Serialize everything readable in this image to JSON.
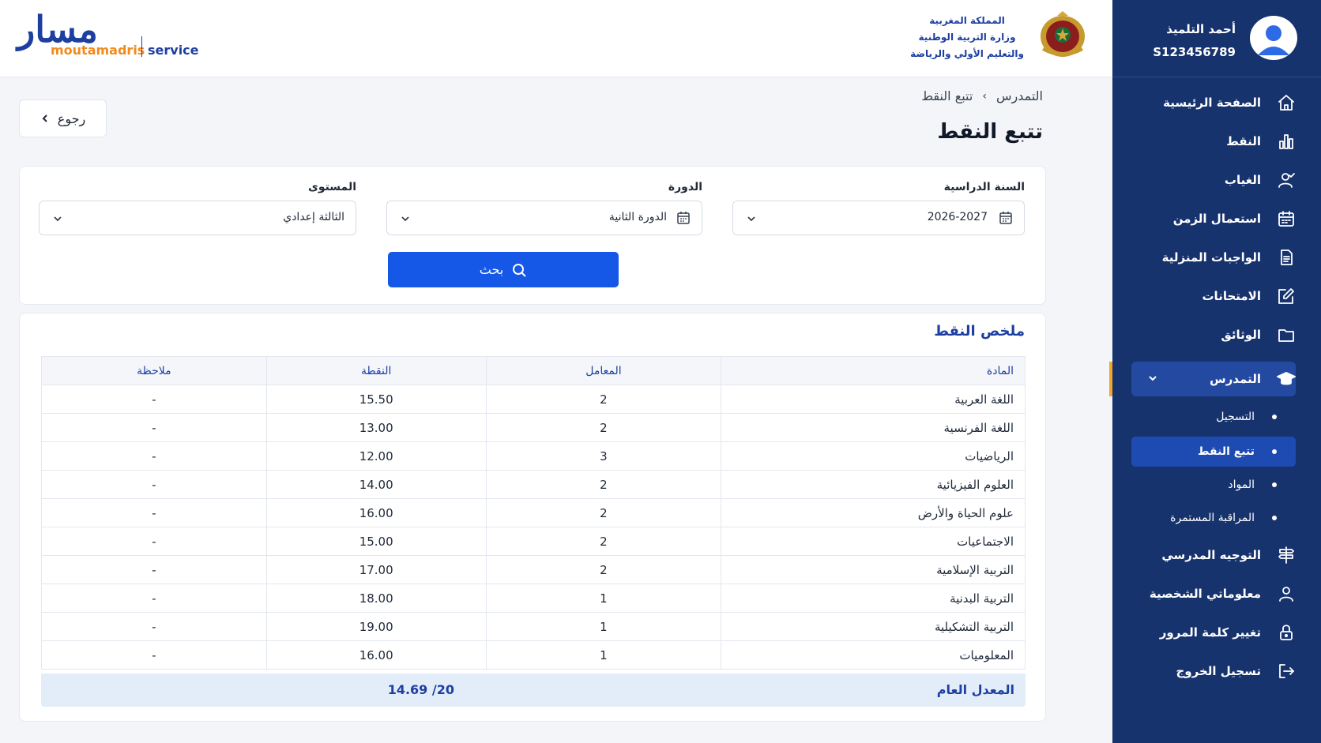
{
  "user": {
    "name": "أحمد التلميذ",
    "id": "S123456789"
  },
  "brand": {
    "logo_ar": "مسار",
    "logo_moutamadris": "moutamadris",
    "logo_service": "service"
  },
  "ministry": {
    "line1": "المملكة المغربية",
    "line2": "وزارة التربية الوطنية",
    "line3": "والتعليم الأولي والرياضة"
  },
  "sidebar": {
    "items": [
      {
        "label": "الصفحة الرئيسية",
        "icon": "home-icon"
      },
      {
        "label": "النقط",
        "icon": "bar-chart-icon"
      },
      {
        "label": "الغياب",
        "icon": "user-check-icon"
      },
      {
        "label": "استعمال الزمن",
        "icon": "calendar-icon"
      },
      {
        "label": "الواجبات المنزلية",
        "icon": "document-icon"
      },
      {
        "label": "الامتحانات",
        "icon": "edit-icon"
      },
      {
        "label": "الوثائق",
        "icon": "folder-icon"
      },
      {
        "label": "التمدرس",
        "icon": "graduation-cap-icon"
      },
      {
        "label": "التوجيه المدرسي",
        "icon": "signpost-icon"
      },
      {
        "label": "معلوماتي الشخصية",
        "icon": "user-icon"
      },
      {
        "label": "تغيير كلمة المرور",
        "icon": "lock-icon"
      },
      {
        "label": "تسجيل الخروج",
        "icon": "logout-icon"
      }
    ],
    "sub_items": [
      {
        "label": "التسجيل"
      },
      {
        "label": "تتبع النقط"
      },
      {
        "label": "المواد"
      },
      {
        "label": "المراقبة المستمرة"
      }
    ],
    "active_item": "التمدرس",
    "active_sub_item": "تتبع النقط"
  },
  "breadcrumb": {
    "parent": "التمدرس",
    "separator": "›",
    "current": "تتبع النقط"
  },
  "page_title": "تتبع النقط",
  "back_button": "رجوع",
  "filters": {
    "year_label": "السنة الدراسية",
    "year_value": "2026-2027",
    "session_label": "الدورة",
    "session_value": "الدورة الثانية",
    "level_label": "المستوى",
    "level_value": "الثالثة إعدادي",
    "search_button": "بحث"
  },
  "summary": {
    "title": "ملخص النقط",
    "columns": {
      "subject": "المادة",
      "coefficient": "المعامل",
      "grade": "النقطة",
      "note": "ملاحظة"
    },
    "rows": [
      {
        "subject": "اللغة العربية",
        "coefficient": "2",
        "grade": "15.50",
        "note": "-"
      },
      {
        "subject": "اللغة الفرنسية",
        "coefficient": "2",
        "grade": "13.00",
        "note": "-"
      },
      {
        "subject": "الرياضيات",
        "coefficient": "3",
        "grade": "12.00",
        "note": "-"
      },
      {
        "subject": "العلوم الفيزيائية",
        "coefficient": "2",
        "grade": "14.00",
        "note": "-"
      },
      {
        "subject": "علوم الحياة والأرض",
        "coefficient": "2",
        "grade": "16.00",
        "note": "-"
      },
      {
        "subject": "الاجتماعيات",
        "coefficient": "2",
        "grade": "15.00",
        "note": "-"
      },
      {
        "subject": "التربية الإسلامية",
        "coefficient": "2",
        "grade": "17.00",
        "note": "-"
      },
      {
        "subject": "التربية البدنية",
        "coefficient": "1",
        "grade": "18.00",
        "note": "-"
      },
      {
        "subject": "التربية التشكيلية",
        "coefficient": "1",
        "grade": "19.00",
        "note": "-"
      },
      {
        "subject": "المعلوميات",
        "coefficient": "1",
        "grade": "16.00",
        "note": "-"
      }
    ],
    "average_label": "المعدل العام",
    "average_value": "14.69 /20"
  },
  "colors": {
    "sidebar_bg": "#17336e",
    "primary": "#1557e6",
    "brand_blue": "#1d3fa0",
    "brand_orange": "#f08a1c",
    "active_mark": "#f5a623"
  }
}
